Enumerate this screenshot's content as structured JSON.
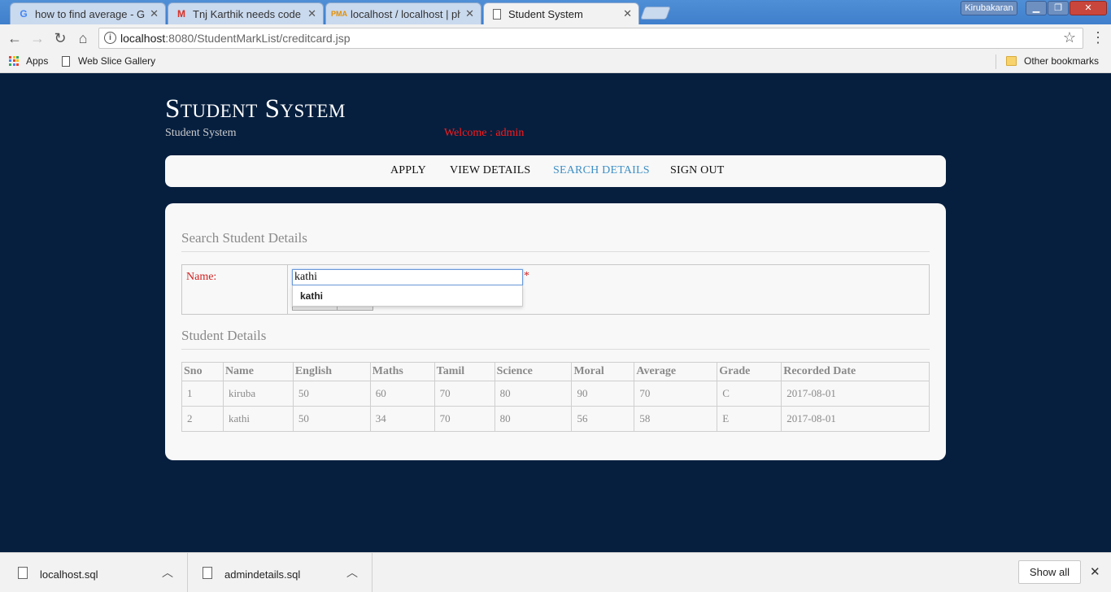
{
  "browser": {
    "tabs": [
      {
        "title": "how to find average - Go",
        "icon": "google-icon",
        "active": false
      },
      {
        "title": "Tnj Karthik needs code -",
        "icon": "gmail-icon",
        "active": false
      },
      {
        "title": "localhost / localhost | ph",
        "icon": "phpmyadmin-icon",
        "active": false
      },
      {
        "title": "Student System",
        "icon": "page-icon",
        "active": true
      }
    ],
    "profile_name": "Kirubakaran",
    "address": {
      "host": "localhost",
      "path": ":8080/StudentMarkList/creditcard.jsp"
    },
    "bookmarks": [
      {
        "label": "Apps",
        "icon": "apps-grid-icon"
      },
      {
        "label": "Web Slice Gallery",
        "icon": "page-icon"
      }
    ],
    "other_bookmarks": "Other bookmarks"
  },
  "site": {
    "title": "Student System",
    "subtitle": "Student System",
    "welcome": "Welcome : admin"
  },
  "nav": {
    "items": [
      "APPLY",
      "VIEW DETAILS",
      "SEARCH DETAILS",
      "SIGN OUT"
    ],
    "current": "SEARCH DETAILS"
  },
  "search": {
    "heading": "Search Student Details",
    "name_label": "Name:",
    "name_value": "kathi",
    "required_mark": "*",
    "suggestion": "kathi"
  },
  "details": {
    "heading": "Student Details",
    "columns": [
      "Sno",
      "Name",
      "English",
      "Maths",
      "Tamil",
      "Science",
      "Moral",
      "Average",
      "Grade",
      "Recorded Date"
    ],
    "rows": [
      [
        "1",
        "kiruba",
        "50",
        "60",
        "70",
        "80",
        "90",
        "70",
        "C",
        "2017-08-01"
      ],
      [
        "2",
        "kathi",
        "50",
        "34",
        "70",
        "80",
        "56",
        "58",
        "E",
        "2017-08-01"
      ]
    ]
  },
  "downloads": {
    "items": [
      {
        "filename": "localhost.sql"
      },
      {
        "filename": "admindetails.sql"
      }
    ],
    "show_all": "Show all"
  },
  "colors": {
    "page_bg": "#061f3f",
    "accent_link": "#3d8fc6",
    "error_red": "#d32020"
  }
}
